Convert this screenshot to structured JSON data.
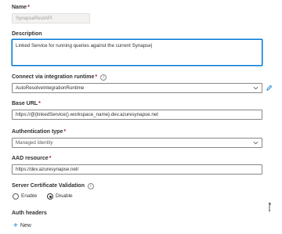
{
  "name": {
    "label": "Name",
    "required_mark": "*",
    "value": "SynapseRestAPI"
  },
  "description": {
    "label": "Description",
    "value": "Linked Service for running queries against the current Synapse|"
  },
  "integration_runtime": {
    "label": "Connect via integration runtime",
    "required_mark": "*",
    "value": "AutoResolveIntegrationRuntime"
  },
  "base_url": {
    "label": "Base URL",
    "required_mark": "*",
    "value": "https://@{linkedService().workspace_name}.dev.azuresynapse.net"
  },
  "auth_type": {
    "label": "Authentication type",
    "required_mark": "*",
    "value": "Managed Identity"
  },
  "aad_resource": {
    "label": "AAD resource",
    "required_mark": "*",
    "value": "https://dev.azuresynapse.net/"
  },
  "cert_validation": {
    "label": "Server Certificate Validation",
    "options": [
      {
        "label": "Enable",
        "selected": false
      },
      {
        "label": "Disable",
        "selected": true
      }
    ]
  },
  "auth_headers": {
    "label": "Auth headers",
    "new_label": "New"
  },
  "icons": {
    "info": "info-icon",
    "chevron": "chevron-down-icon",
    "edit": "pencil-icon",
    "add": "plus-icon"
  },
  "colors": {
    "accent": "#0078d4",
    "required": "#a4262c",
    "text": "#323130"
  }
}
